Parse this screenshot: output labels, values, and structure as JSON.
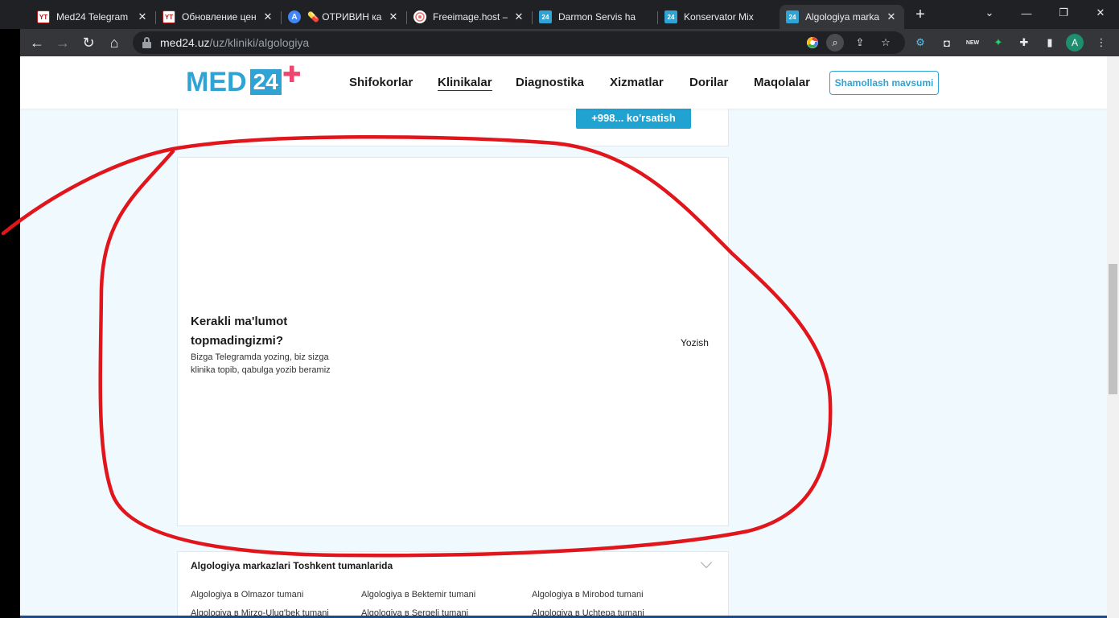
{
  "browser": {
    "tabs": [
      {
        "title": "Med24 Telegram",
        "icon": "yt-icon"
      },
      {
        "title": "Обновление цен",
        "icon": "yt-icon"
      },
      {
        "title": "💊 ОТРИВИН ка",
        "icon": "a-icon"
      },
      {
        "title": "Freeimage.host –",
        "icon": "freeimage-icon"
      },
      {
        "title": "Darmon Servis ha",
        "icon": "med24-icon"
      },
      {
        "title": "Konservator Mix",
        "icon": "med24-icon"
      },
      {
        "title": "Algologiya marka",
        "icon": "med24-icon"
      }
    ],
    "url_host": "med24.uz",
    "url_path": "/uz/kliniki/algologiya",
    "favicon_label": "24",
    "yt_label": "YT",
    "a_label": "A",
    "avatar_letter": "A",
    "new_label": "NEW"
  },
  "site": {
    "logo_text": "MED",
    "logo_number": "24",
    "nav": [
      "Shifokorlar",
      "Klinikalar",
      "Diagnostika",
      "Xizmatlar",
      "Dorilar",
      "Maqolalar"
    ],
    "season_button": "Shamollash mavsumi"
  },
  "phone_button": "+998... ko'rsatish",
  "info": {
    "title": "Kerakli ma'lumot topmadingizmi?",
    "description": "Bizga Telegramda yozing, biz sizga klinika topib, qabulga yozib beramiz",
    "link": "Yozish"
  },
  "districts": {
    "title": "Algologiya markazlari Toshkent tumanlarida",
    "links": [
      "Algologiya в Olmazor tumani",
      "Algologiya в Bektemir tumani",
      "Algologiya в Mirobod tumani",
      "Algologiya в Mirzo-Ulug'bek tumani",
      "Algologiya в Sergeli tumani",
      "Algologiya в Uchtepa tumani"
    ]
  },
  "colors": {
    "brand": "#2fa3d3",
    "accent_plus": "#f0456e",
    "annotation": "#e0161c",
    "page_bg": "#f0fafe"
  }
}
